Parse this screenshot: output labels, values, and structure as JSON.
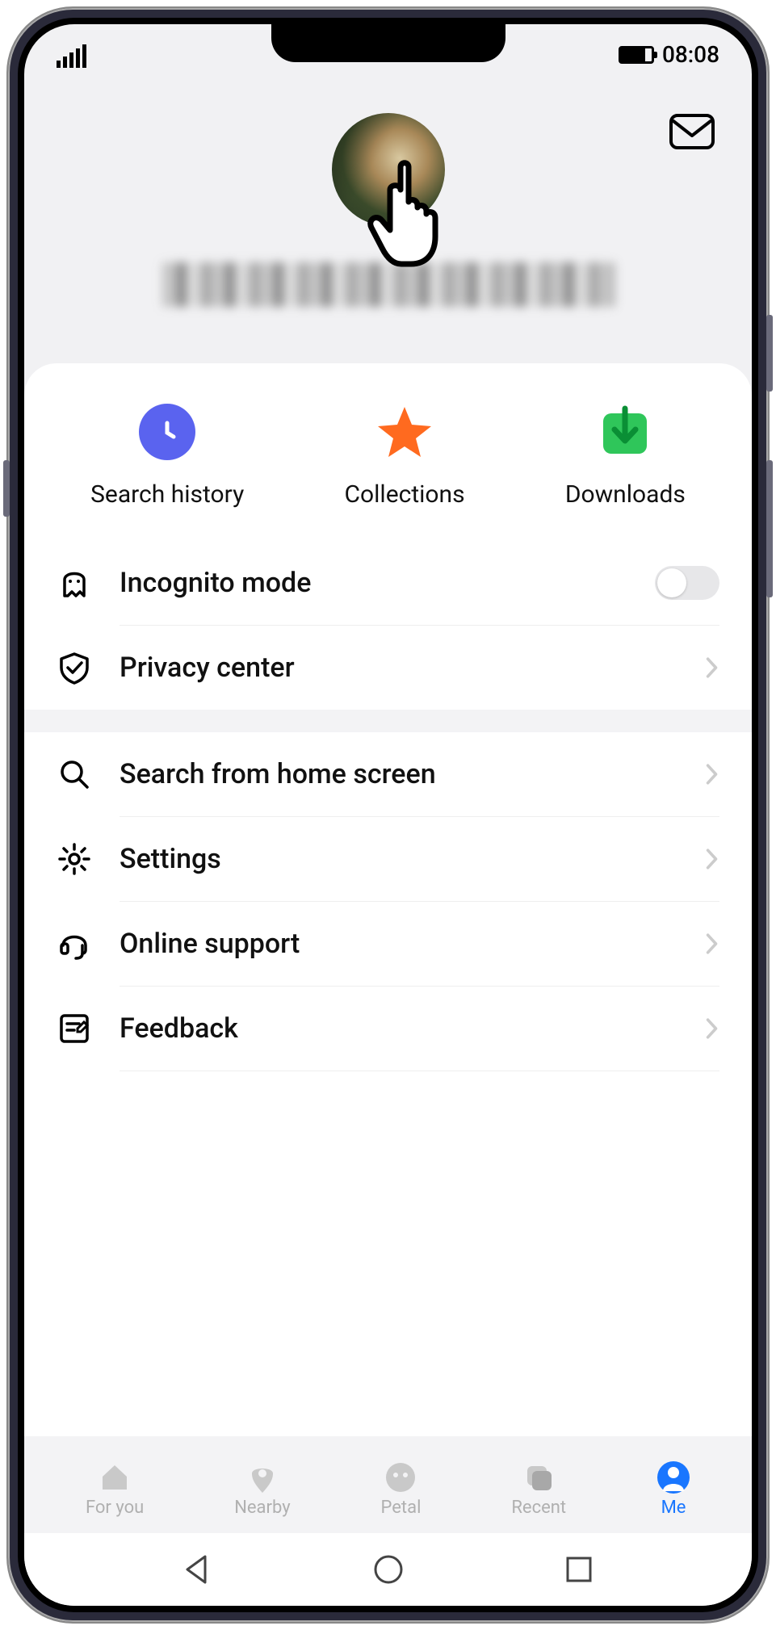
{
  "status": {
    "time": "08:08"
  },
  "header": {
    "username_redacted": true
  },
  "tiles": [
    {
      "label": "Search history",
      "icon": "clock",
      "color": "#5a63ef"
    },
    {
      "label": "Collections",
      "icon": "star",
      "color": "#ff6a1f"
    },
    {
      "label": "Downloads",
      "icon": "download",
      "color": "#2fc65a"
    }
  ],
  "rows_group1": [
    {
      "label": "Incognito mode",
      "icon": "ghost",
      "type": "toggle",
      "value": false
    },
    {
      "label": "Privacy center",
      "icon": "shield",
      "type": "link"
    }
  ],
  "rows_group2": [
    {
      "label": "Search from home screen",
      "icon": "search",
      "type": "link"
    },
    {
      "label": "Settings",
      "icon": "gear",
      "type": "link"
    },
    {
      "label": "Online support",
      "icon": "headset",
      "type": "link"
    },
    {
      "label": "Feedback",
      "icon": "feedback",
      "type": "link"
    }
  ],
  "tabs": [
    {
      "label": "For you",
      "icon": "home"
    },
    {
      "label": "Nearby",
      "icon": "pin"
    },
    {
      "label": "Petal",
      "icon": "face"
    },
    {
      "label": "Recent",
      "icon": "stack"
    },
    {
      "label": "Me",
      "icon": "person",
      "active": true
    }
  ]
}
